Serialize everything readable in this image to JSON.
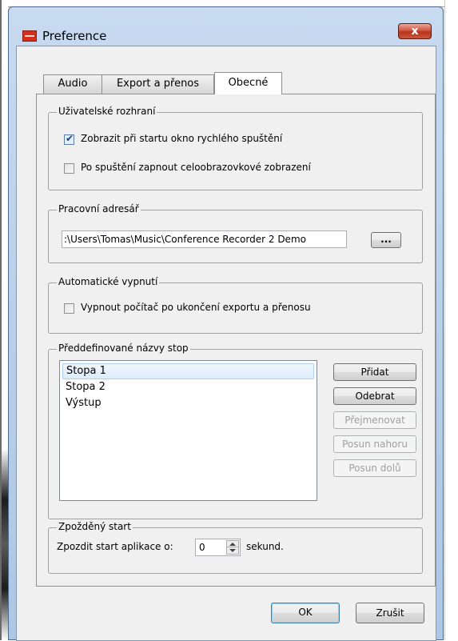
{
  "window": {
    "title": "Preference",
    "close_label": "x"
  },
  "tabs": [
    {
      "label": "Audio",
      "active": false
    },
    {
      "label": "Export a přenos",
      "active": false
    },
    {
      "label": "Obecné",
      "active": true
    }
  ],
  "ui_group": {
    "legend": "Uživatelské rozhraní",
    "options": [
      {
        "label": "Zobrazit při startu okno rychlého spuštění",
        "checked": true
      },
      {
        "label": "Po spuštění zapnout celoobrazovkové zobrazení",
        "checked": false
      }
    ]
  },
  "workdir_group": {
    "legend": "Pracovní adresář",
    "path_value": ":\\Users\\Tomas\\Music\\Conference Recorder 2 Demo",
    "browse_label": "..."
  },
  "shutdown_group": {
    "legend": "Automatické vypnutí",
    "option": {
      "label": "Vypnout počítač po ukončení exportu a přenosu",
      "checked": false
    }
  },
  "tracks_group": {
    "legend": "Předdefinované názvy stop",
    "items": [
      "Stopa 1",
      "Stopa 2",
      "Výstup"
    ],
    "selected_index": 0,
    "buttons": {
      "add": "Přidat",
      "remove": "Odebrat",
      "rename": "Přejmenovat",
      "move_up": "Posun nahoru",
      "move_down": "Posun dolů"
    }
  },
  "delay_group": {
    "legend": "Zpožděný start",
    "label": "Zpozdit start aplikace o:",
    "value": "0",
    "unit": "sekund."
  },
  "footer": {
    "ok_label": "OK",
    "cancel_label": "Zrušit"
  },
  "colors": {
    "titlebar": "#b7cde8",
    "close_button": "#c9553c",
    "selection": "#dcebfc"
  }
}
